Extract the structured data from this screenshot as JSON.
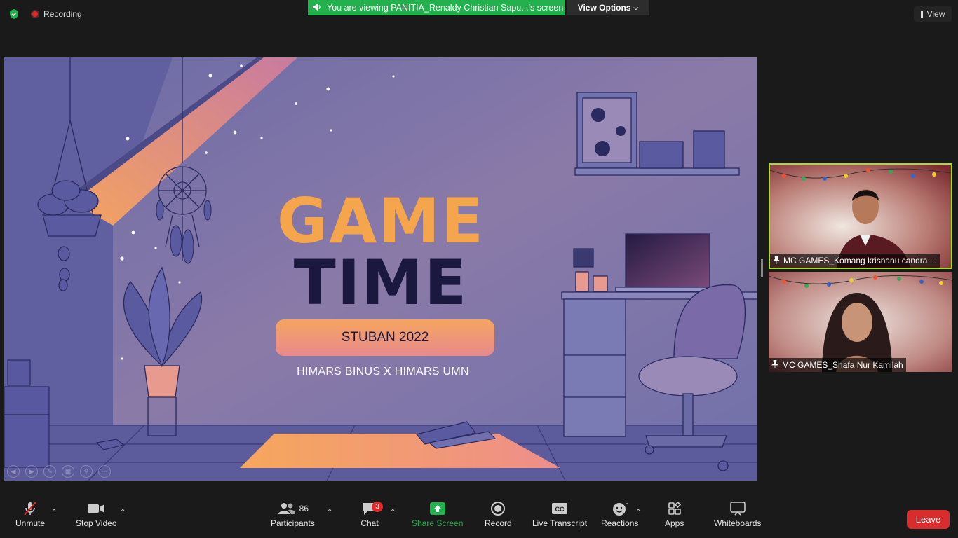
{
  "topbar": {
    "recording_label": "Recording",
    "viewing_banner": "You are viewing PANITIA_Renaldy Christian Sapu...'s screen",
    "view_options_label": "View Options",
    "view_label": "View"
  },
  "slide": {
    "title_line1": "GAME",
    "title_line2": "TIME",
    "event_name": "STUBAN 2022",
    "subtitle": "HIMARS BINUS X HIMARS UMN"
  },
  "participants_tiles": [
    {
      "name": "MC GAMES_Komang krisnanu candra ...",
      "active_speaker": true
    },
    {
      "name": "MC GAMES_Shafa Nur Kamilah",
      "active_speaker": false
    }
  ],
  "toolbar": {
    "unmute_label": "Unmute",
    "stop_video_label": "Stop Video",
    "participants_label": "Participants",
    "participants_count": "86",
    "chat_label": "Chat",
    "chat_badge": "3",
    "share_screen_label": "Share Screen",
    "record_label": "Record",
    "live_transcript_label": "Live Transcript",
    "reactions_label": "Reactions",
    "apps_label": "Apps",
    "whiteboards_label": "Whiteboards",
    "leave_label": "Leave"
  },
  "colors": {
    "viewing_banner": "#23b14d",
    "share_screen_icon": "#23b14d",
    "active_speaker_border": "#a6e022",
    "leave": "#d92d2d",
    "game_text": "#f5a54b",
    "time_text": "#1b1840"
  }
}
